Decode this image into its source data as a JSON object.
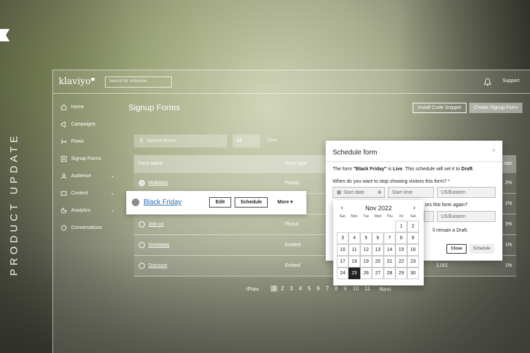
{
  "banner": {
    "vertical_text": "PRODUCT UPDATE"
  },
  "topbar": {
    "logo": "klaviyo",
    "search_placeholder": "Search for someone...",
    "support": "Support"
  },
  "sidebar": {
    "items": [
      {
        "label": "Home",
        "icon": "home-icon"
      },
      {
        "label": "Campaigns",
        "icon": "campaigns-icon"
      },
      {
        "label": "Flows",
        "icon": "flows-icon"
      },
      {
        "label": "Signup Forms",
        "icon": "forms-icon"
      },
      {
        "label": "Audience",
        "icon": "audience-icon"
      },
      {
        "label": "Content",
        "icon": "content-icon"
      },
      {
        "label": "Analytics",
        "icon": "analytics-icon"
      },
      {
        "label": "Conversations",
        "icon": "conversations-icon"
      }
    ]
  },
  "main": {
    "title": "Signup Forms",
    "install_snippet": "Install Code Snippet",
    "create_form": "Create Signup Form",
    "search_placeholder": "Search forms",
    "filter": "All",
    "clear": "Clear"
  },
  "table": {
    "headers": {
      "name": "Form name",
      "type": "Form type",
      "rate": "rate"
    },
    "rows": [
      {
        "name": "Multistep",
        "type": "Popup",
        "views": "",
        "rate": "2%"
      },
      {
        "name": "Black Friday",
        "type": "",
        "views": "",
        "rate": "1%"
      },
      {
        "name": "Join us",
        "type": "Flyout",
        "views": "",
        "rate": "3%"
      },
      {
        "name": "Giveaway",
        "type": "Embed",
        "views": "",
        "rate": "1%"
      },
      {
        "name": "Discount",
        "type": "Embed",
        "views": "2,001",
        "rate": "1%"
      }
    ]
  },
  "highlight": {
    "name": "Black Friday",
    "edit": "Edit",
    "schedule": "Schedule",
    "more": "More"
  },
  "pagination": {
    "prev": "Prev",
    "pages": [
      "1",
      "2",
      "3",
      "4",
      "5",
      "6",
      "7",
      "8",
      "9",
      "10",
      "11"
    ],
    "next": "Next"
  },
  "modal": {
    "title": "Schedule form",
    "close_x": "×",
    "desc_prefix": "The form ",
    "desc_form": "\"Black Friday\"",
    "desc_mid": " is ",
    "desc_live": "Live",
    "desc_mid2": ". This schedule will set it to ",
    "desc_draft": "Draft",
    "desc_end": ".",
    "question1": "When do you want to stop showing visitors this form? *",
    "start_date": "Start date",
    "start_time": "Start time",
    "timezone": "US/Eastern",
    "question2_partial": "ors this form again?",
    "timezone2": "US/Eastern",
    "remain_draft": "ll remain a Draft.",
    "close_btn": "Close",
    "schedule_btn": "Schedule"
  },
  "calendar": {
    "month": "Nov 2022",
    "dows": [
      "Sun",
      "Mon",
      "Tue",
      "Wed",
      "Thu",
      "Fri",
      "Sat"
    ],
    "weeks": [
      [
        "",
        "",
        "",
        "",
        "",
        "1",
        "2"
      ],
      [
        "3",
        "4",
        "5",
        "6",
        "7",
        "8",
        "9"
      ],
      [
        "10",
        "11",
        "12",
        "13",
        "14",
        "15",
        "16"
      ],
      [
        "17",
        "18",
        "19",
        "20",
        "21",
        "22",
        "23"
      ],
      [
        "24",
        "25",
        "26",
        "27",
        "28",
        "29",
        "30"
      ]
    ],
    "selected": "25"
  }
}
